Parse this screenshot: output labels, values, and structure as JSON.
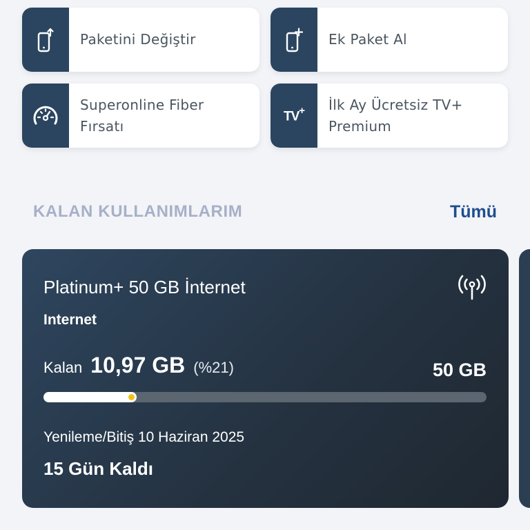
{
  "actions": [
    {
      "label": "Paketini Değiştir",
      "icon": "phone-upgrade-icon"
    },
    {
      "label": "Ek Paket Al",
      "icon": "phone-add-icon"
    },
    {
      "label": "Superonline Fiber Fırsatı",
      "icon": "speedometer-icon"
    },
    {
      "label": "İlk Ay Ücretsiz TV+ Premium",
      "icon": "tv-plus-icon",
      "glyph": "TV",
      "glyph_sup": "+"
    }
  ],
  "section": {
    "title": "KALAN KULLANIMLARIM",
    "see_all": "Tümü"
  },
  "usage_card": {
    "title": "Platinum+ 50 GB İnternet",
    "type": "Internet",
    "remaining_label": "Kalan",
    "remaining_value": "10,97 GB",
    "remaining_percent": "(%21)",
    "remaining_fraction": 0.21,
    "total": "50 GB",
    "renewal": "Yenileme/Bitiş 10 Haziran 2025",
    "days_left": "15 Gün Kaldı",
    "icon": "signal-antenna-icon"
  },
  "colors": {
    "tile_icon_bg": "#2b4560",
    "section_title": "#a6b0c8",
    "link": "#1f4d8f",
    "card_bg": "#26384a",
    "progress_track": "#5b6670",
    "progress_fill": "#ffffff",
    "progress_marker": "#f2c21b"
  }
}
